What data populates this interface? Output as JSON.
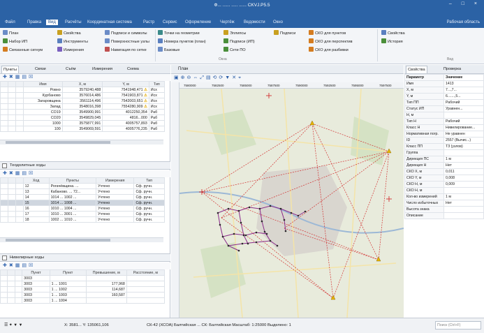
{
  "window": {
    "title": "Ф... ...... ..... ...... CKVJ.P5.5",
    "controls": "–  □  ×"
  },
  "menu": {
    "items": [
      "Файл",
      "Правка",
      "Вид",
      "Расчёты",
      "Координатная система",
      "Растр",
      "Сервис",
      "Оформление",
      "Чертёж",
      "Ведомости",
      "Окно"
    ],
    "active_index": 2,
    "right_label": "Рабочая область"
  },
  "ribbon": {
    "buttons": [
      {
        "label": "План",
        "color": "#6b8cc7"
      },
      {
        "label": "Набор ИП",
        "color": "#4a8e3a"
      },
      {
        "label": "Связанные сигнум",
        "color": "#d47c20"
      },
      {
        "label": "Свойства",
        "color": "#c9a020"
      },
      {
        "label": "Инструменты",
        "color": "#5a7fbf"
      },
      {
        "label": "Измерения",
        "color": "#7a5fbf"
      },
      {
        "label": "Подписи и символы",
        "color": "#6b8cc7"
      },
      {
        "label": "Поверхностные узлы",
        "color": "#6b8cc7"
      },
      {
        "label": "Навигация по сетке",
        "color": "#c05050"
      },
      {
        "label": "Точки на геометрии",
        "color": "#3a8a8a"
      },
      {
        "label": "Номера пунктов (план)",
        "color": "#5a7fbf"
      },
      {
        "label": "Базовые",
        "color": "#6b8cc7"
      },
      {
        "label": "Эллипсы",
        "color": "#c9a020"
      },
      {
        "label": "Подписи (ИП)",
        "color": "#4a8e3a"
      },
      {
        "label": "Сети ПО",
        "color": "#4a8e3a"
      },
      {
        "label": "Подписи",
        "color": "#c9a020"
      },
      {
        "label": "СКО для пунктов",
        "color": "#d47c20"
      },
      {
        "label": "СКО для перспектив",
        "color": "#d47c20"
      },
      {
        "label": "СКО для разбивки",
        "color": "#d47c20"
      },
      {
        "label": "Свойства",
        "color": "#5a7fbf"
      },
      {
        "label": "История",
        "color": "#4a8e3a"
      }
    ],
    "groups": [
      "Окна",
      "Вид"
    ]
  },
  "left_panel": {
    "tabs": [
      "Пункты",
      "Связи",
      "Съём",
      "Измерения",
      "Схема"
    ],
    "points_table": {
      "headers": [
        "",
        "",
        "",
        "Имя",
        "X, м",
        "Y, м",
        "Тип"
      ],
      "rows": [
        {
          "name": "Ровно",
          "x": "3579240,488",
          "y": "7541948,471",
          "warn": true,
          "type": "Исх"
        },
        {
          "name": "Курбаново",
          "x": "3576014,486",
          "y": "7541903,871",
          "warn": true,
          "type": "Исх"
        },
        {
          "name": "Загаровщина",
          "x": "3561114,496",
          "y": "7542003,651",
          "warn": true,
          "type": "Исх"
        },
        {
          "name": "Запад",
          "x": "3548016,398",
          "y": "7554280,909",
          "warn": true,
          "type": "Исх"
        },
        {
          "name": "СО19",
          "x": "3549900,991",
          "y": "4012250,354",
          "warn": false,
          "type": "Раб"
        },
        {
          "name": "СО20",
          "x": "3549829,045",
          "y": "4816...000",
          "warn": false,
          "type": "Раб"
        },
        {
          "name": "1000",
          "x": "3575877,991",
          "y": "4005757,893",
          "warn": false,
          "type": "Раб"
        },
        {
          "name": "100",
          "x": "3549069,591",
          "y": "4005776,235",
          "warn": false,
          "type": "Раб"
        }
      ]
    },
    "lines_section": {
      "title": "Теодолитные ходы",
      "headers": [
        "",
        "",
        "",
        "Ход",
        "Пункты",
        "Измерения",
        "Тип"
      ],
      "rows": [
        {
          "id": "12",
          "points": "Рогачёвщина. ...",
          "meas": "Учтено",
          "type": "Сф. ручн."
        },
        {
          "id": "13",
          "points": "Кабаново. ... 72...",
          "meas": "Учтено",
          "type": "Сф. ручн."
        },
        {
          "id": "14",
          "points": "1014 ... 1002 ...",
          "meas": "Учтено",
          "type": "Сф. ручн."
        },
        {
          "id": "15",
          "points": "1014 ... 1008 ...",
          "meas": "Учтено",
          "type": "Сф. ручн."
        },
        {
          "id": "16",
          "points": "1010 ... 1004 ...",
          "meas": "Учтено",
          "type": "Сф. ручн."
        },
        {
          "id": "17",
          "points": "1010 ... 3001 ...",
          "meas": "Учтено",
          "type": "Сф. ручн."
        },
        {
          "id": "18",
          "points": "1002 ... 1010 ...",
          "meas": "Учтено",
          "type": "Сф. ручн."
        }
      ]
    },
    "levels_section": {
      "title": "Нивелирные ходы",
      "headers": [
        "",
        "",
        "",
        "Пункт",
        "Пункт",
        "Превышение, м",
        "Расстояние, м"
      ],
      "rows": [
        {
          "a": "3003",
          "b": "",
          "h": "",
          "d": ""
        },
        {
          "a": "3003",
          "b": "1 ... 1001",
          "h": "177,968",
          "d": ""
        },
        {
          "a": "3003",
          "b": "1 ... 1002",
          "h": "114,687",
          "d": ""
        },
        {
          "a": "3003",
          "b": "1 ... 1003",
          "h": "160,587",
          "d": ""
        },
        {
          "a": "3003",
          "b": "1 ... 1004",
          "h": "",
          "d": ""
        }
      ]
    }
  },
  "map": {
    "tab_title": "План",
    "ruler_marks": [
      "7580000",
      "7582500",
      "7585000",
      "7587500",
      "7590000",
      "7592500",
      "7595000",
      "7597500"
    ]
  },
  "right_panel": {
    "tabs": [
      "Свойства",
      "Проверка"
    ],
    "properties": [
      {
        "k": "Параметр",
        "v": "Значение"
      },
      {
        "k": "Имя",
        "v": "1413"
      },
      {
        "k": "X, м",
        "v": "7...,7..."
      },
      {
        "k": "Y, м",
        "v": "6.......,5..."
      },
      {
        "k": "Тип ПП",
        "v": "Рабочий"
      },
      {
        "k": "Статус ИП",
        "v": "Уравнен..."
      },
      {
        "k": "Н, м",
        "v": ""
      },
      {
        "k": "Тип Н",
        "v": "Рабочий"
      },
      {
        "k": "Класс Н",
        "v": "Нивелирование..."
      },
      {
        "k": "Нормативная погр.",
        "v": "Не уравнен"
      },
      {
        "k": "ID",
        "v": "2557 (Вычис...)"
      },
      {
        "k": "Класс ПП",
        "v": "ТЗ (узлов)"
      },
      {
        "k": "Группа",
        "v": ""
      },
      {
        "k": "Дирекция ПС",
        "v": "1 м"
      },
      {
        "k": "Дирекция Н",
        "v": "Нет"
      },
      {
        "k": "СКО X, м",
        "v": "0,011"
      },
      {
        "k": "СКО Y, м",
        "v": "0,008"
      },
      {
        "k": "СКО Н, м",
        "v": "0,009"
      },
      {
        "k": "СКО Н, м",
        "v": ""
      },
      {
        "k": "Кол-во измерений",
        "v": "1 м"
      },
      {
        "k": "Число избыточных",
        "v": "Нет"
      },
      {
        "k": "Высота знака",
        "v": ""
      },
      {
        "k": "Описание",
        "v": ""
      }
    ]
  },
  "status": {
    "coords": "X: 3581...  Y: 135061,106",
    "system": "СК-42 (ХСОА) Балтийская ...  СК: Балтийская  Масштаб: 1:25000  Выделено: 1",
    "search_placeholder": "Поиск (Ctrl+F)"
  }
}
